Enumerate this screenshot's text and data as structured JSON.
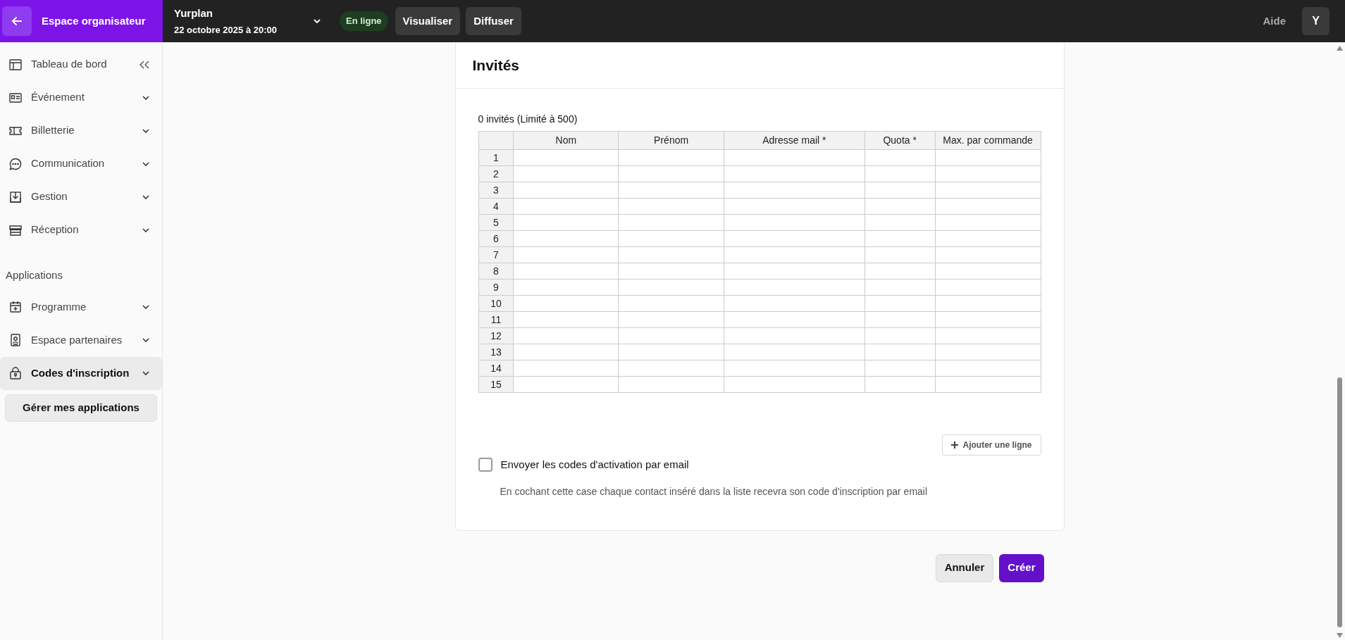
{
  "topbar": {
    "back_label": "Espace organisateur",
    "event_name": "Yurplan",
    "event_date": "22 octobre 2025 à 20:00",
    "status": "En ligne",
    "buttons": [
      "Visualiser",
      "Diffuser"
    ],
    "help": "Aide",
    "avatar": "Y"
  },
  "sidebar": {
    "items": [
      {
        "label": "Tableau de bord",
        "selected": false
      },
      {
        "label": "Événement",
        "selected": false
      },
      {
        "label": "Billetterie",
        "selected": false
      },
      {
        "label": "Communication",
        "selected": false
      },
      {
        "label": "Gestion",
        "selected": false
      },
      {
        "label": "Réception",
        "selected": false
      }
    ],
    "section_title": "Applications",
    "apps": [
      {
        "label": "Programme",
        "selected": false
      },
      {
        "label": "Espace partenaires",
        "selected": false
      },
      {
        "label": "Codes d'inscription",
        "selected": true
      }
    ],
    "manage_button": "Gérer mes applications"
  },
  "card": {
    "title": "Invités",
    "count": "0 invités (Limité à 500)",
    "table": {
      "columns": [
        "Nom",
        "Prénom",
        "Adresse mail *",
        "Quota *",
        "Max. par commande"
      ],
      "rows": [
        "1",
        "2",
        "3",
        "4",
        "5",
        "6",
        "7",
        "8",
        "9",
        "10",
        "11",
        "12",
        "13",
        "14",
        "15"
      ]
    },
    "add_row_button": "Ajouter une ligne",
    "checkbox": {
      "label": "Envoyer les codes d'activation par email",
      "checked": false
    },
    "hint": "En cochant cette case chaque contact inséré dans la liste recevra son code d'inscription par email"
  },
  "actions": {
    "cancel": "Annuler",
    "create": "Créer"
  }
}
